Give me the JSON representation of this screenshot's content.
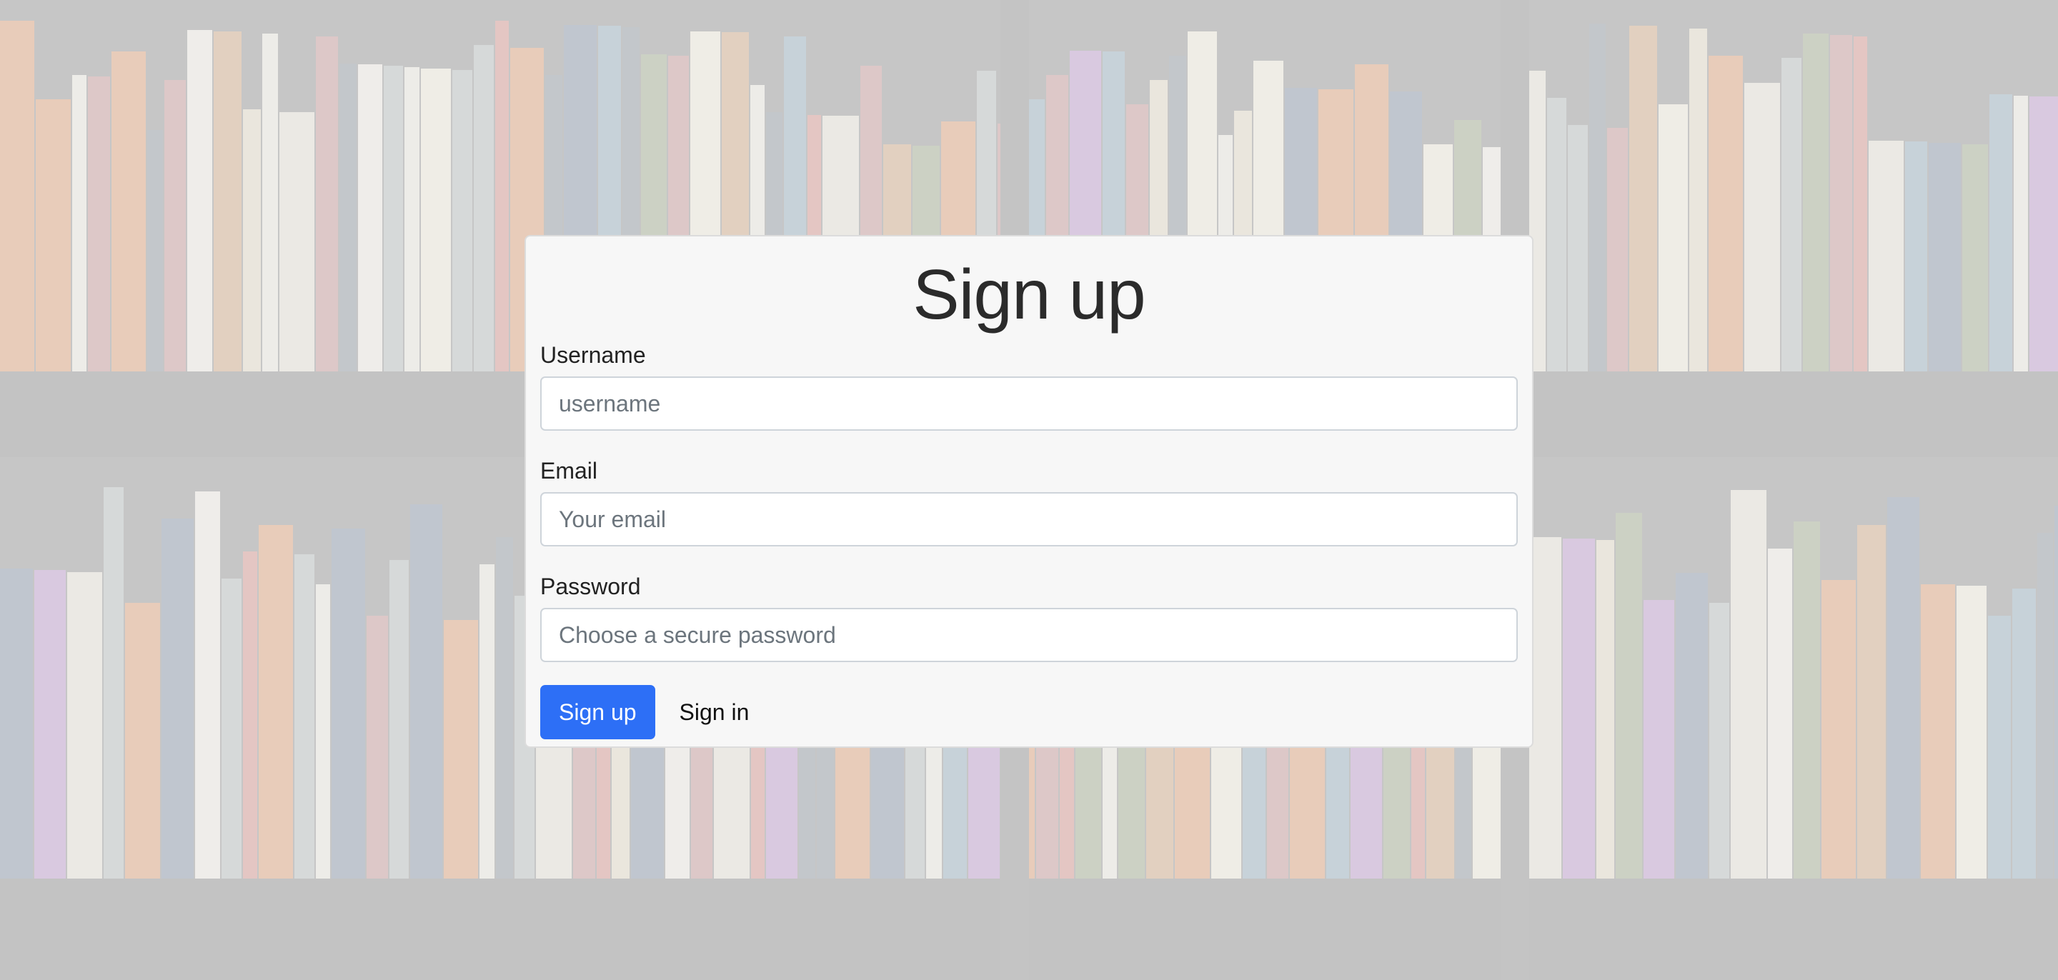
{
  "page": {
    "title": "Sign up"
  },
  "form": {
    "username": {
      "label": "Username",
      "placeholder": "username",
      "value": ""
    },
    "email": {
      "label": "Email",
      "placeholder": "Your email",
      "value": ""
    },
    "password": {
      "label": "Password",
      "placeholder": "Choose a secure password",
      "value": ""
    },
    "submit_label": "Sign up",
    "signin_label": "Sign in"
  },
  "colors": {
    "primary": "#2d6ff6",
    "card_background": "#f7f7f7"
  }
}
